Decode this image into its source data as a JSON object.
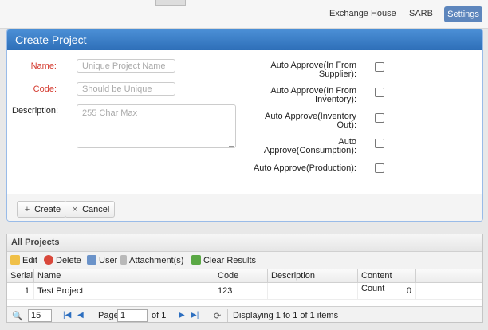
{
  "nav": {
    "items": [
      "Exchange House",
      "SARB"
    ],
    "active": "Settings"
  },
  "form": {
    "title": "Create Project",
    "name_label": "Name:",
    "name_placeholder": "Unique Project Name",
    "code_label": "Code:",
    "code_placeholder": "Should be Unique",
    "desc_label": "Description:",
    "desc_placeholder": "255 Char Max",
    "checks": [
      {
        "line1": "Auto Approve(In From",
        "line2": "Supplier):"
      },
      {
        "line1": "Auto Approve(In From",
        "line2": "Inventory):"
      },
      {
        "line1": "Auto Approve(Inventory",
        "line2": "Out):"
      },
      {
        "line1": "Auto",
        "line2": "Approve(Consumption):"
      },
      {
        "line1": "Auto Approve(Production):",
        "line2": ""
      }
    ],
    "create_label": "Create",
    "cancel_label": "Cancel"
  },
  "grid": {
    "title": "All Projects",
    "toolbar": [
      "Edit",
      "Delete",
      "User",
      "Attachment(s)",
      "Clear Results"
    ],
    "columns": [
      "Serial",
      "Name",
      "Code",
      "Description",
      "Content Count"
    ],
    "rows": [
      {
        "serial": "1",
        "name": "Test Project",
        "code": "123",
        "description": "",
        "count": "0"
      }
    ],
    "pager": {
      "page_size": "15",
      "page_label": "Page",
      "page": "1",
      "of": "of 1",
      "status": "Displaying 1 to 1 of 1 items"
    }
  },
  "colors": {
    "header": "#2e6fb8",
    "accent": "#5d86bd",
    "required": "#d43a2f"
  },
  "icons": [
    "plus-icon",
    "close-icon",
    "edit-icon",
    "delete-icon",
    "user-icon",
    "attachment-icon",
    "clear-icon",
    "search-icon",
    "first-page-icon",
    "prev-page-icon",
    "next-page-icon",
    "last-page-icon",
    "refresh-icon"
  ]
}
